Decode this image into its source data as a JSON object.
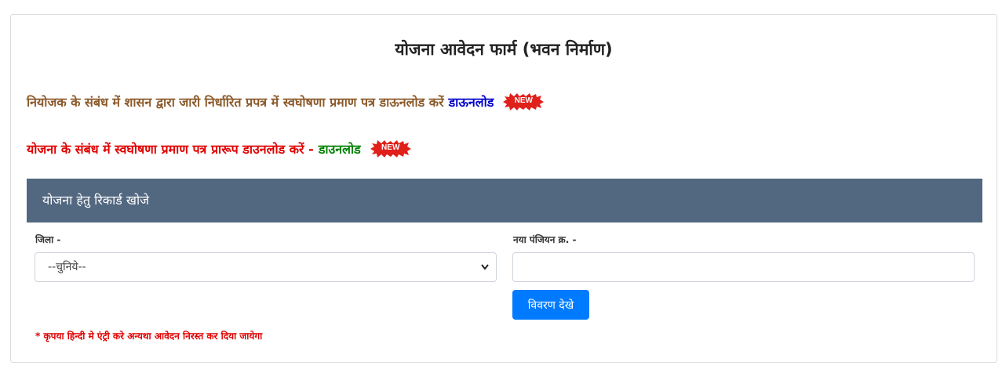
{
  "page": {
    "title": "योजना आवेदन फार्म (भवन निर्माण)"
  },
  "notices": [
    {
      "text": "नियोजक के संबंध में शासन द्वारा जारी निर्धारित प्रपत्र में स्वघोषणा प्रमाण पत्र डाऊनलोड करें",
      "link": "डाऊनलोड",
      "badge": "NEW"
    },
    {
      "text": "योजना के संबंध में स्वघोषणा प्रमाण पत्र प्रारूप डाउनलोड करें -",
      "link": "डाउनलोड",
      "badge": "NEW"
    }
  ],
  "search": {
    "header": "योजना हेतु रिकार्ड खोजे",
    "district_label": "जिला -",
    "district_value": "--चुनिये--",
    "registration_label": "नया पंजियन क्र. -",
    "registration_value": "",
    "submit_label": "विवरण देखे",
    "note": "* कृपया हिन्दी मे एंट्री करे अन्यथा आवेदन निरस्त कर दिया जायेगा"
  },
  "colors": {
    "header_bg": "#526780",
    "primary_button": "#007bff",
    "notice_brown": "#8b5a2b",
    "notice_red": "#e00000",
    "link_blue": "#0000cc",
    "link_green": "#008000",
    "badge_red": "#e0201a"
  }
}
